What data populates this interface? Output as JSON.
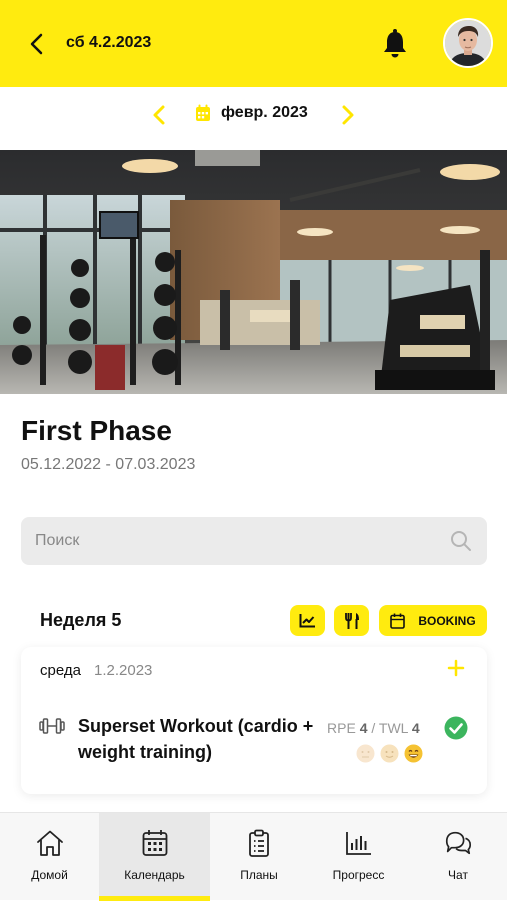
{
  "header": {
    "date": "сб 4.2.2023"
  },
  "month_nav": {
    "label": "февр. 2023"
  },
  "phase": {
    "title": "First Phase",
    "dates": "05.12.2022 - 07.03.2023"
  },
  "search": {
    "placeholder": "Поиск",
    "value": ""
  },
  "week": {
    "title": "Неделя 5",
    "booking_label": "BOOKING"
  },
  "day_card": {
    "day": "среда",
    "date": "1.2.2023",
    "workout": {
      "title": "Superset Workout (cardio + weight training)",
      "rpe_label": "RPE",
      "rpe_value": "4",
      "separator": "/",
      "twl_label": "TWL",
      "twl_value": "4",
      "completed": true
    }
  },
  "bottom_nav": {
    "items": [
      {
        "label": "Домой",
        "icon": "home-icon",
        "active": false
      },
      {
        "label": "Календарь",
        "icon": "calendar-icon",
        "active": true
      },
      {
        "label": "Планы",
        "icon": "clipboard-icon",
        "active": false
      },
      {
        "label": "Прогресс",
        "icon": "bar-chart-icon",
        "active": false
      },
      {
        "label": "Чат",
        "icon": "chat-icon",
        "active": false
      }
    ]
  },
  "colors": {
    "accent": "#ffeb0f",
    "check": "#3cb55e",
    "nav_bg": "#f7f7f7"
  }
}
